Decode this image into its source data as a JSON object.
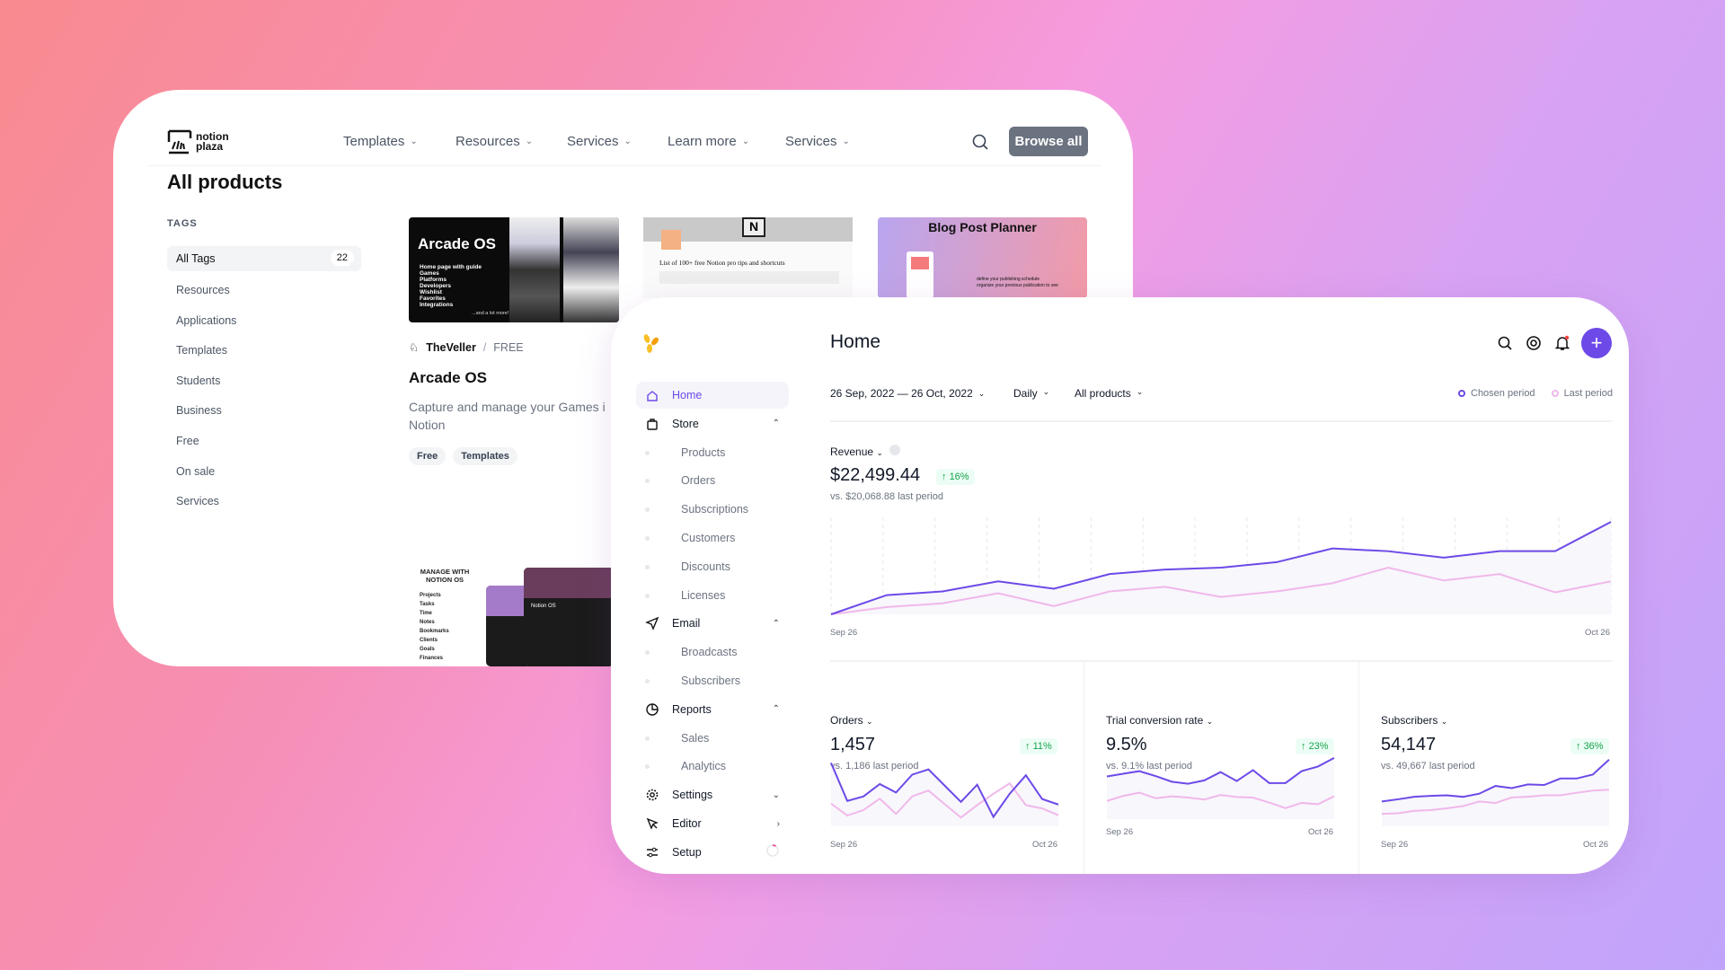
{
  "back": {
    "logo": "notion plaza",
    "nav": [
      {
        "label": "Templates"
      },
      {
        "label": "Resources"
      },
      {
        "label": "Services"
      },
      {
        "label": "Learn more"
      },
      {
        "label": "Services"
      }
    ],
    "browse_label": "Browse all",
    "page_title": "All products",
    "tags_heading": "TAGS",
    "tags": [
      {
        "label": "All Tags",
        "count": "22"
      },
      {
        "label": "Resources"
      },
      {
        "label": "Applications"
      },
      {
        "label": "Templates"
      },
      {
        "label": "Students"
      },
      {
        "label": "Business"
      },
      {
        "label": "Free"
      },
      {
        "label": "On sale"
      },
      {
        "label": "Services"
      }
    ],
    "cards": {
      "arcade_thumb": {
        "title": "Arcade OS",
        "items": [
          "Home page with guide",
          "Games",
          "Platforms",
          "Developers",
          "Wishlist",
          "Favorites",
          "Integrations"
        ],
        "footer": "...and a lot more!"
      },
      "tips_thumb": {
        "title": "List of 100+ free Notion pro tips and shortcuts"
      },
      "blog_thumb": {
        "title": "Blog Post Planner",
        "items": [
          "define your publishing schedule",
          "organize your previous publication to see"
        ]
      },
      "notionos_thumb": {
        "title": "MANAGE WITH NOTION OS",
        "items": [
          "Projects",
          "Tasks",
          "Time",
          "Notes",
          "Bookmarks",
          "Clients",
          "Goals",
          "Finances"
        ],
        "screen_label": "Notion OS"
      }
    },
    "product": {
      "author": "TheVeller",
      "price": "FREE",
      "name": "Arcade OS",
      "description": "Capture and manage your Games i Notion",
      "tags": [
        "Free",
        "Templates"
      ]
    }
  },
  "front": {
    "title": "Home",
    "accent": "#6d4ae8",
    "sidebar": [
      {
        "label": "Home",
        "icon": "home-icon",
        "active": true
      },
      {
        "label": "Store",
        "icon": "bag-icon",
        "caret": "^"
      },
      {
        "label": "Products",
        "sub": true
      },
      {
        "label": "Orders",
        "sub": true
      },
      {
        "label": "Subscriptions",
        "sub": true
      },
      {
        "label": "Customers",
        "sub": true
      },
      {
        "label": "Discounts",
        "sub": true
      },
      {
        "label": "Licenses",
        "sub": true
      },
      {
        "label": "Email",
        "icon": "send-icon",
        "caret": "^"
      },
      {
        "label": "Broadcasts",
        "sub": true
      },
      {
        "label": "Subscribers",
        "sub": true
      },
      {
        "label": "Reports",
        "icon": "pie-icon",
        "caret": "^"
      },
      {
        "label": "Sales",
        "sub": true
      },
      {
        "label": "Analytics",
        "sub": true
      },
      {
        "label": "Settings",
        "icon": "gear-icon",
        "caret": "v"
      },
      {
        "label": "Editor",
        "icon": "cursor-icon",
        "caret": ">"
      },
      {
        "label": "Setup",
        "icon": "sliders-icon",
        "progress": 0.1
      }
    ],
    "filters": {
      "date_range": "26 Sep, 2022  —  26 Oct, 2022",
      "interval": "Daily",
      "products": "All products"
    },
    "legend": {
      "chosen": "Chosen period",
      "last": "Last period",
      "chosen_color": "#6d4ae8",
      "last_color": "#f0b8ea"
    }
  },
  "chart_data": [
    {
      "type": "line",
      "id": "revenue",
      "label": "Revenue",
      "value": "$22,499.44",
      "change": "16%",
      "comparison": "vs. $20,068.88 last period",
      "x_ticks": [
        "Sep 26",
        "Oct 26"
      ],
      "grid": "vertical dashed",
      "series": [
        {
          "name": "Chosen period",
          "values": [
            0,
            21,
            25,
            36,
            28,
            44,
            49,
            51,
            57,
            72,
            69,
            62,
            69,
            69,
            101
          ]
        },
        {
          "name": "Last period",
          "values": [
            0,
            8,
            12,
            23,
            9,
            25,
            30,
            19,
            25,
            34,
            51,
            37,
            44,
            24,
            36
          ]
        }
      ],
      "ylim": [
        0,
        105
      ]
    },
    {
      "type": "line",
      "id": "orders",
      "label": "Orders",
      "value": "1,457",
      "change": "11%",
      "comparison": "vs. 1,186 last period",
      "x_ticks": [
        "Sep 26",
        "Oct 26"
      ],
      "series": [
        {
          "name": "Chosen period",
          "values": [
            195,
            78,
            92,
            130,
            104,
            159,
            175,
            125,
            75,
            128,
            29,
            100,
            157,
            84,
            67
          ]
        },
        {
          "name": "Last period",
          "values": [
            70,
            33,
            50,
            85,
            38,
            92,
            110,
            68,
            27,
            65,
            100,
            132,
            65,
            55,
            34
          ]
        }
      ],
      "ylim": [
        0,
        210
      ]
    },
    {
      "type": "line",
      "id": "trial",
      "label": "Trial conversion rate",
      "value": "9.5%",
      "change": "23%",
      "comparison": "vs. 9.1% last period",
      "x_ticks": [
        "Sep 26",
        "Oct 26"
      ],
      "series": [
        {
          "name": "Chosen period",
          "values": [
            129,
            137,
            145,
            130,
            113,
            107,
            117,
            142,
            115,
            148,
            109,
            109,
            145,
            159,
            185
          ]
        },
        {
          "name": "Last period",
          "values": [
            55,
            70,
            80,
            63,
            69,
            65,
            59,
            73,
            67,
            65,
            50,
            33,
            49,
            45,
            69
          ]
        }
      ],
      "ylim": [
        0,
        190
      ]
    },
    {
      "type": "line",
      "id": "subscribers",
      "label": "Subscribers",
      "value": "54,147",
      "change": "36%",
      "comparison": "vs. 49,667 last period",
      "x_ticks": [
        "Sep 26",
        "Oct 26"
      ],
      "series": [
        {
          "name": "Chosen period",
          "values": [
            80,
            87,
            95,
            98,
            100,
            95,
            105,
            130,
            123,
            135,
            133,
            154,
            154,
            167,
            215
          ]
        },
        {
          "name": "Last period",
          "values": [
            40,
            42,
            50,
            52,
            58,
            65,
            80,
            75,
            93,
            95,
            100,
            100,
            108,
            115,
            118
          ]
        }
      ],
      "ylim": [
        0,
        220
      ]
    }
  ]
}
